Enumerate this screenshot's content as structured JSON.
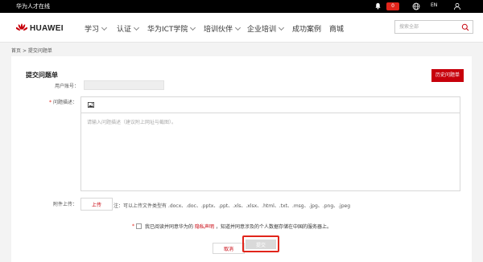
{
  "topbar": {
    "site_name": "华为人才在线",
    "notification_count": "0",
    "language": "EN"
  },
  "header": {
    "brand": "HUAWEI",
    "nav": [
      "学习",
      "认证",
      "华为ICT学院",
      "培训伙伴",
      "企业培训",
      "成功案例",
      "商城"
    ],
    "search_placeholder": "搜索全部"
  },
  "breadcrumb": {
    "home": "首页",
    "separator": ">",
    "current": "提交问题单"
  },
  "form": {
    "title": "提交问题单",
    "history_button": "历史问题单",
    "username_label": "用户账号：",
    "username_value": "",
    "description_label": "问题描述：",
    "description_placeholder": "请输入问题描述（建议附上网址与截图）。",
    "attachment_label": "附件上传：",
    "upload_button": "上传",
    "upload_note": "注：可以上传文件类型有 .docx、.doc、.pptx、.ppt、.xls、.xlsx、.html、.txt、.msg、.jpg、.png、.jpeg",
    "agree_prefix": "我已阅读并同意华为的",
    "privacy_link": "隐私声明",
    "agree_suffix": "，知道并同意涉及的个人数据存储在中国的服务器上。",
    "cancel_button": "取消",
    "submit_button": "提交"
  },
  "colors": {
    "brand_red": "#c7000b",
    "badge_red": "#e1251b"
  }
}
